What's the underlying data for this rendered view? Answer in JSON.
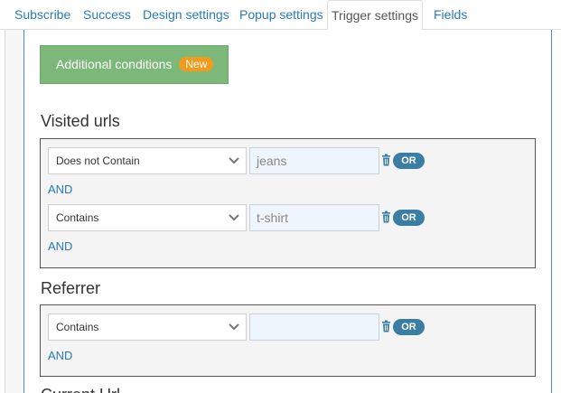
{
  "tabs": [
    {
      "label": "Subscribe"
    },
    {
      "label": "Success"
    },
    {
      "label": "Design settings"
    },
    {
      "label": "Popup settings"
    },
    {
      "label": "Trigger settings"
    },
    {
      "label": "Fields"
    }
  ],
  "additional_conditions": {
    "label": "Additional conditions",
    "badge": "New"
  },
  "visited_urls": {
    "title": "Visited urls",
    "rows": [
      {
        "condition": "Does not Contain",
        "value": "jeans",
        "or_label": "OR"
      },
      {
        "condition": "Contains",
        "value": "t-shirt",
        "or_label": "OR"
      }
    ],
    "and_label": "AND"
  },
  "referrer": {
    "title": "Referrer",
    "rows": [
      {
        "condition": "Contains",
        "value": "",
        "or_label": "OR"
      }
    ],
    "and_label": "AND"
  },
  "next_section": {
    "title": "Current Url"
  },
  "colors": {
    "accent": "#2a7ab8",
    "button_green": "#7cb879",
    "badge": "#f29a1b",
    "or_pill": "#3a7ea4"
  }
}
